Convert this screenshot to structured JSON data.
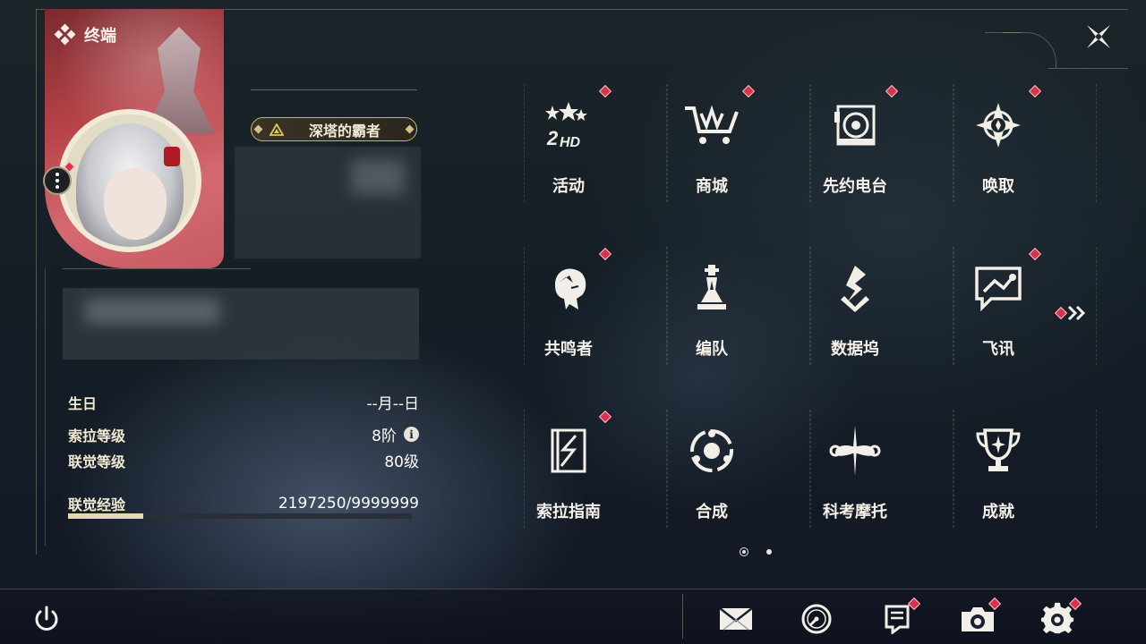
{
  "header": {
    "title": "终端"
  },
  "profile": {
    "title_badge": "深塔的霸者",
    "stats": [
      {
        "label": "生日",
        "value": "--月--日"
      },
      {
        "label": "索拉等级",
        "value": "8阶"
      },
      {
        "label": "联觉等级",
        "value": "80级"
      },
      {
        "label": "联觉经验",
        "value": "2197250/9999999"
      }
    ],
    "exp_progress": 0.22
  },
  "menu": [
    {
      "label": "活动",
      "icon": "event-2hd-icon",
      "badge": true
    },
    {
      "label": "商城",
      "icon": "shop-cart-icon",
      "badge": true
    },
    {
      "label": "先约电台",
      "icon": "radio-icon",
      "badge": true
    },
    {
      "label": "唤取",
      "icon": "convene-icon",
      "badge": true
    },
    {
      "label": "共鸣者",
      "icon": "resonator-icon",
      "badge": true
    },
    {
      "label": "编队",
      "icon": "team-chess-icon",
      "badge": false
    },
    {
      "label": "数据坞",
      "icon": "data-bank-icon",
      "badge": false
    },
    {
      "label": "飞讯",
      "icon": "message-icon",
      "badge": true
    },
    {
      "label": "索拉指南",
      "icon": "guidebook-icon",
      "badge": true
    },
    {
      "label": "合成",
      "icon": "synthesis-icon",
      "badge": false
    },
    {
      "label": "科考摩托",
      "icon": "motorcycle-icon",
      "badge": false
    },
    {
      "label": "成就",
      "icon": "trophy-icon",
      "badge": false
    }
  ],
  "pagination": {
    "pages": 2,
    "current": 1
  },
  "bottom": {
    "left": "power-icon",
    "right": [
      {
        "icon": "mail-icon",
        "badge": false
      },
      {
        "icon": "clock-icon",
        "badge": false
      },
      {
        "icon": "notice-icon",
        "badge": true
      },
      {
        "icon": "camera-icon",
        "badge": true
      },
      {
        "icon": "settings-gear-icon",
        "badge": true
      }
    ]
  },
  "colors": {
    "accent": "#e8d7b4",
    "badge": "#d8334a",
    "text": "#f5f1e8"
  }
}
